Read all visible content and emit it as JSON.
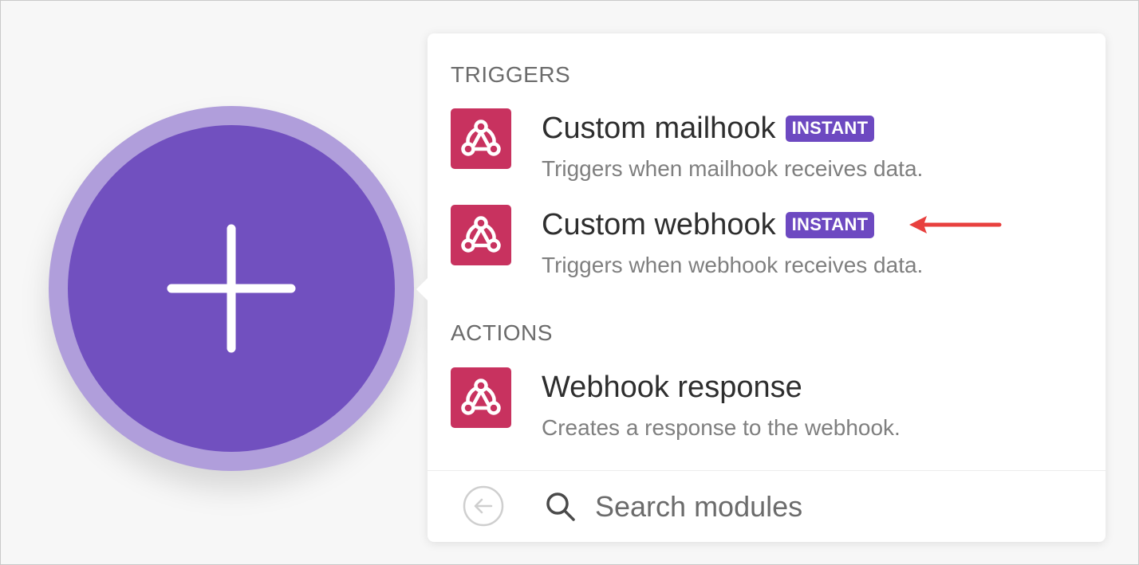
{
  "colors": {
    "background": "#f7f7f7",
    "add_button_ring": "#b09edb",
    "add_button": "#7150bf",
    "module_icon": "#c8325f",
    "badge": "#6d49c1",
    "annotation_arrow": "#e8403e"
  },
  "add_button": {
    "icon": "plus-icon"
  },
  "panel": {
    "sections": [
      {
        "title": "TRIGGERS",
        "modules": [
          {
            "icon": "webhook-icon",
            "name": "Custom mailhook",
            "badge": "INSTANT",
            "description": "Triggers when mailhook receives data."
          },
          {
            "icon": "webhook-icon",
            "name": "Custom webhook",
            "badge": "INSTANT",
            "description": "Triggers when webhook receives data."
          }
        ]
      },
      {
        "title": "ACTIONS",
        "modules": [
          {
            "icon": "webhook-icon",
            "name": "Webhook response",
            "description": "Creates a response to the webhook."
          }
        ]
      }
    ],
    "footer": {
      "back_icon": "arrow-left-circle-icon",
      "search_icon": "search-icon",
      "search_placeholder": "Search modules",
      "search_value": ""
    }
  }
}
